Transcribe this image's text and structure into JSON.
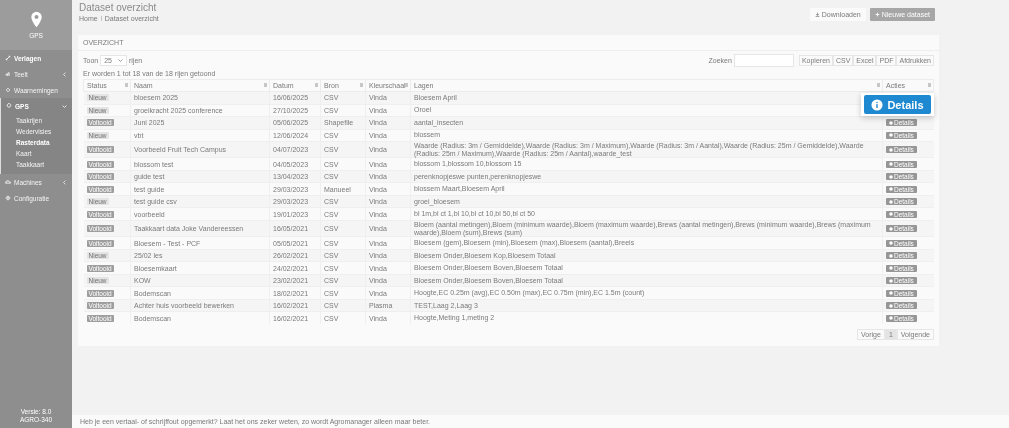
{
  "sidebar": {
    "logo_label": "GPS",
    "items": [
      {
        "label": "Verlagen",
        "selected": true
      },
      {
        "label": "Teelt",
        "selected": false,
        "expanded": false
      },
      {
        "label": "Waarnemingen",
        "selected": false
      },
      {
        "label": "GPS",
        "selected": true,
        "expanded": true,
        "children": [
          {
            "label": "Taakrijen",
            "selected": false
          },
          {
            "label": "Wedervisies",
            "selected": false
          },
          {
            "label": "Rasterdata",
            "selected": true
          },
          {
            "label": "Kaart",
            "selected": false
          },
          {
            "label": "Taakkaart",
            "selected": false
          }
        ]
      },
      {
        "label": "Machines",
        "selected": false,
        "expanded": false
      },
      {
        "label": "Configuratie",
        "selected": false
      }
    ],
    "version": [
      "Versie: 8.0",
      "AGRO-340"
    ]
  },
  "page": {
    "title": "Dataset overzicht",
    "breadcrumb": [
      "Home",
      "Dataset overzicht"
    ],
    "buttons": [
      "Downloaden",
      "Nieuwe dataset"
    ]
  },
  "card": {
    "title": "OVERZICHT",
    "length_prefix": "Toon",
    "length_value": "25",
    "length_suffix": "rijen",
    "search_label": "Zoeken",
    "export_buttons": [
      "Kopieren",
      "CSV",
      "Excel",
      "PDF",
      "Afdrukken"
    ],
    "info": "Er worden 1 tot 18 van de 18 rijen getoond"
  },
  "table": {
    "columns": [
      "Status",
      "Naam",
      "Datum",
      "Bron",
      "Kleurschaal",
      "Lagen",
      "Acties"
    ],
    "rows": [
      {
        "status": "Nieuw",
        "kind": "new",
        "name": "bloesem 2025",
        "date": "16/06/2025",
        "source": "CSV",
        "scale": "Vinda",
        "layers": "Bloesem April"
      },
      {
        "status": "Nieuw",
        "kind": "new",
        "name": "groeikracht 2025 conference",
        "date": "27/10/2025",
        "source": "CSV",
        "scale": "Vinda",
        "layers": "Oroel"
      },
      {
        "status": "Voltooid",
        "kind": "done",
        "name": "Juni 2025",
        "date": "05/06/2025",
        "source": "Shapefile",
        "scale": "Vinda",
        "layers": "aantal_insecten",
        "action": "Details"
      },
      {
        "status": "Nieuw",
        "kind": "new",
        "name": "vbt",
        "date": "12/06/2024",
        "source": "CSV",
        "scale": "Vinda",
        "layers": "blossem",
        "action": "Details"
      },
      {
        "status": "Voltooid",
        "kind": "done",
        "name": "Voorbeeld Fruit Tech Campus",
        "date": "04/07/2023",
        "source": "CSV",
        "scale": "Vinda",
        "layers": "Waarde (Radius: 3m / Gemiddelde),Waarde (Radius: 3m / Maximum),Waarde (Radius: 3m / Aantal),Waarde (Radius: 25m / Gemiddelde),Waarde (Radius: 25m / Maximum),Waarde (Radius: 25m / Aantal),waarde_test",
        "action": "Details"
      },
      {
        "status": "Voltooid",
        "kind": "done",
        "name": "blossom test",
        "date": "04/05/2023",
        "source": "CSV",
        "scale": "Vinda",
        "layers": "blossom 1,blossom 10,blossom 15",
        "action": "Details"
      },
      {
        "status": "Voltooid",
        "kind": "done",
        "name": "guide test",
        "date": "13/04/2023",
        "source": "CSV",
        "scale": "Vinda",
        "layers": "perenknopjeswe punten,perenknopjeswe",
        "action": "Details"
      },
      {
        "status": "Voltooid",
        "kind": "done",
        "name": "test guide",
        "date": "29/03/2023",
        "source": "Manueel",
        "scale": "Vinda",
        "layers": "blossem Maart,Bloesem April",
        "action": "Details"
      },
      {
        "status": "Nieuw",
        "kind": "new",
        "name": "test guide csv",
        "date": "29/03/2023",
        "source": "CSV",
        "scale": "Vinda",
        "layers": "groei_bloesem",
        "action": "Details"
      },
      {
        "status": "Voltooid",
        "kind": "done",
        "name": "voorbeeld",
        "date": "19/01/2023",
        "source": "CSV",
        "scale": "Vinda",
        "layers": "bl 1m,bl ct 1,bl 10,bl ct 10,bl 50,bl ct 50",
        "action": "Details"
      },
      {
        "status": "Voltooid",
        "kind": "done",
        "name": "Taakkaart data Joke Vandereessen",
        "date": "16/05/2021",
        "source": "CSV",
        "scale": "Vinda",
        "layers": "Bloem (aantal metingen),Bloem (minimum waarde),Bloem (maximum waarde),Brews (aantal metingen),Brews (minimum waarde),Brews (maximum waarde),Bloem (sum),Brews (sum)",
        "action": "Details"
      },
      {
        "status": "Voltooid",
        "kind": "done",
        "name": "Bloesem - Test - PCF",
        "date": "05/05/2021",
        "source": "CSV",
        "scale": "Vinda",
        "layers": "Bloesem (gem),Bloesem (min),Bloesem (max),Bloesem (aantal),Breeis",
        "action": "Details"
      },
      {
        "status": "Nieuw",
        "kind": "new",
        "name": "25/02 les",
        "date": "26/02/2021",
        "source": "CSV",
        "scale": "Vinda",
        "layers": "Bloesem Onder,Bloesem Kop,Bloesem Totaal",
        "action": "Details"
      },
      {
        "status": "Voltooid",
        "kind": "done",
        "name": "Bloesemkaart",
        "date": "24/02/2021",
        "source": "CSV",
        "scale": "Vinda",
        "layers": "Bloesem Onder,Bloesem Boven,Bloesem Totaal",
        "action": "Details"
      },
      {
        "status": "Nieuw",
        "kind": "new",
        "name": "KOW",
        "date": "23/02/2021",
        "source": "CSV",
        "scale": "Vinda",
        "layers": "Bloesem Onder,Bloesem Boven,Bloesem Totaal",
        "action": "Details"
      },
      {
        "status": "Voltooid",
        "kind": "done",
        "name": "Bodemscan",
        "date": "18/02/2021",
        "source": "CSV",
        "scale": "Vinda",
        "layers": "Hoogte,EC 0.25m (avg),EC 0.50m (max),EC 0.75m (min),EC 1.5m (count)",
        "action": "Details"
      },
      {
        "status": "Voltooid",
        "kind": "done",
        "name": "Achter huis voorbeeld bewerken",
        "date": "16/02/2021",
        "source": "CSV",
        "scale": "Plasma",
        "layers": "TEST,Laag 2,Laag 3",
        "action": "Details"
      },
      {
        "status": "Voltooid",
        "kind": "done",
        "name": "Bodemscan",
        "date": "16/02/2021",
        "source": "CSV",
        "scale": "Vinda",
        "layers": "Hoogte,Meting 1,meting 2",
        "action": "Details"
      }
    ]
  },
  "pagination": [
    {
      "label": "Vorige",
      "selected": false
    },
    {
      "label": "1",
      "selected": true
    },
    {
      "label": "Volgende",
      "selected": false
    }
  ],
  "highlight": {
    "label": "Details"
  },
  "footer": "Heb je een vertaal- of schrijffout opgemerkt? Laat het ons zeker weten, zo wordt Agromanager alleen maar beter."
}
